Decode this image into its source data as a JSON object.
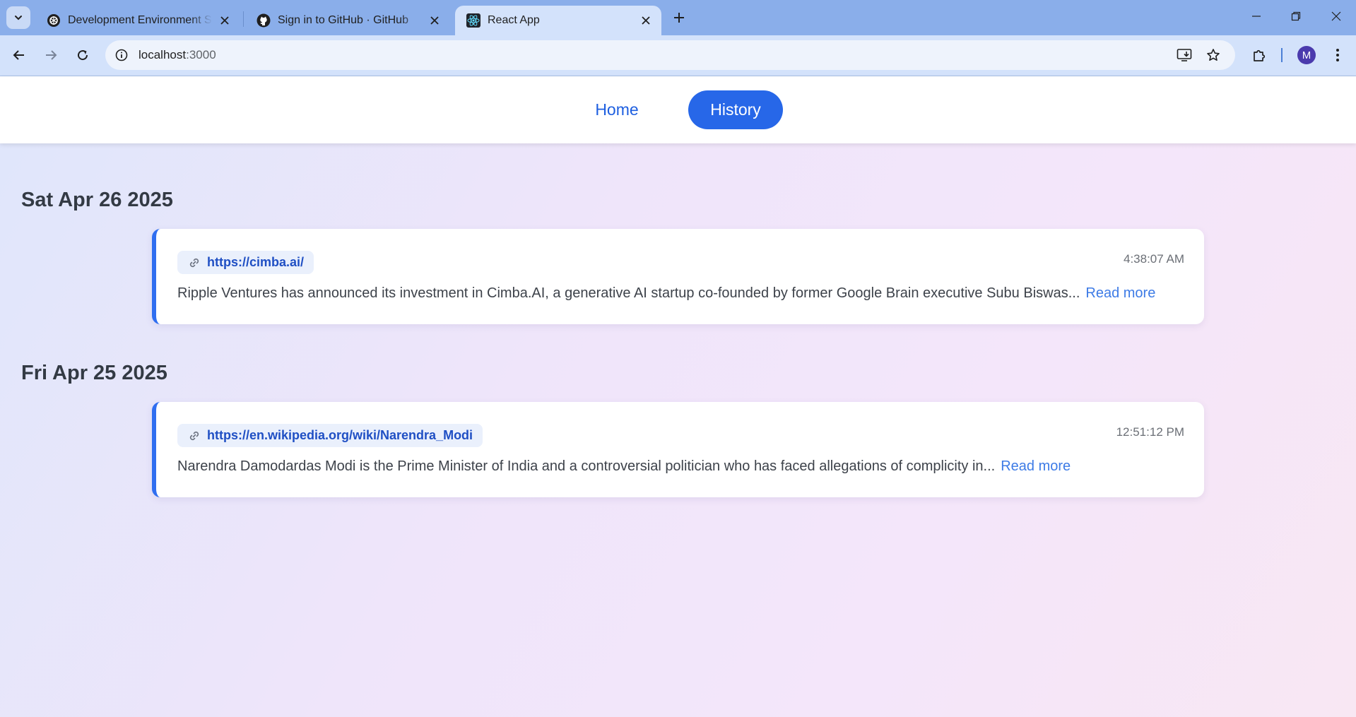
{
  "browser": {
    "tabs": [
      {
        "title": "Development Environment Setup",
        "icon": "openai-icon",
        "active": false
      },
      {
        "title": "Sign in to GitHub · GitHub",
        "icon": "github-icon",
        "active": false
      },
      {
        "title": "React App",
        "icon": "react-icon",
        "active": true
      }
    ],
    "url_host": "localhost",
    "url_port": ":3000",
    "profile_initial": "M"
  },
  "nav": {
    "home_label": "Home",
    "history_label": "History",
    "active": "History"
  },
  "groups": [
    {
      "date": "Sat Apr 26 2025",
      "items": [
        {
          "url": "https://cimba.ai/",
          "time": "4:38:07 AM",
          "summary": "Ripple Ventures has announced its investment in Cimba.AI, a generative AI startup co-founded by former Google Brain executive Subu Biswas...",
          "read_more": "Read more"
        }
      ]
    },
    {
      "date": "Fri Apr 25 2025",
      "items": [
        {
          "url": "https://en.wikipedia.org/wiki/Narendra_Modi",
          "time": "12:51:12 PM",
          "summary": "Narendra Damodardas Modi is the Prime Minister of India and a controversial politician who has faced allegations of complicity in...",
          "read_more": "Read more"
        }
      ]
    }
  ],
  "colors": {
    "accent": "#2767e8",
    "card_border": "#2f6ef0",
    "link": "#1f4fc4",
    "read_more": "#3d7be6"
  }
}
